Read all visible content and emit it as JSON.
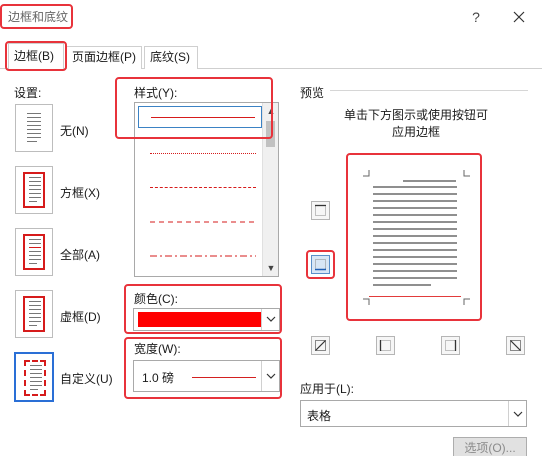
{
  "window": {
    "title": "边框和底纹",
    "help_icon": "?",
    "close_icon": "close-icon"
  },
  "tabs": [
    {
      "label": "边框(B)",
      "active": true
    },
    {
      "label": "页面边框(P)",
      "active": false
    },
    {
      "label": "底纹(S)",
      "active": false
    }
  ],
  "settings": {
    "label": "设置:",
    "items": [
      {
        "label": "无(N)"
      },
      {
        "label": "方框(X)"
      },
      {
        "label": "全部(A)"
      },
      {
        "label": "虚框(D)"
      },
      {
        "label": "自定义(U)",
        "selected": true
      }
    ]
  },
  "style": {
    "label": "样式(Y):",
    "items": [
      {
        "kind": "solid",
        "selected": true
      },
      {
        "kind": "dotted"
      },
      {
        "kind": "dash-small"
      },
      {
        "kind": "dash-large"
      },
      {
        "kind": "dash-dot"
      }
    ]
  },
  "color": {
    "label": "颜色(C):",
    "value": "#ff0000"
  },
  "width": {
    "label": "宽度(W):",
    "value": "1.0 磅"
  },
  "preview": {
    "label": "预览",
    "hint_line1": "单击下方图示或使用按钮可",
    "hint_line2": "应用边框"
  },
  "apply_to": {
    "label": "应用于(L):",
    "value": "表格"
  },
  "options_button": "选项(O)...",
  "colors": {
    "accent_red": "#e8333b",
    "border_red": "#ff0000",
    "selection_blue": "#2a6fd6"
  }
}
